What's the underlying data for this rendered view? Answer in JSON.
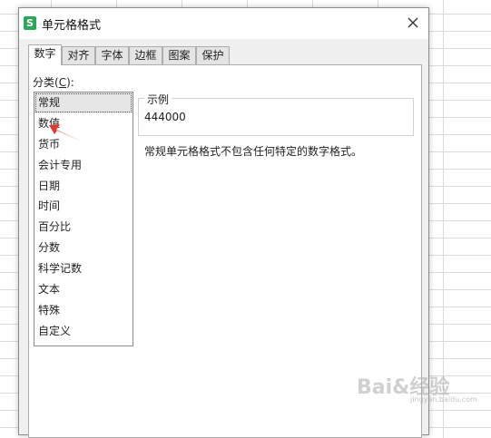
{
  "window": {
    "title": "单元格格式",
    "app_icon_glyph": "S",
    "close_icon": "close-icon"
  },
  "tabs": [
    {
      "label": "数字",
      "active": true
    },
    {
      "label": "对齐",
      "active": false
    },
    {
      "label": "字体",
      "active": false
    },
    {
      "label": "边框",
      "active": false
    },
    {
      "label": "图案",
      "active": false
    },
    {
      "label": "保护",
      "active": false
    }
  ],
  "category": {
    "label_prefix": "分类(",
    "label_accel": "C",
    "label_suffix": "):",
    "items": [
      "常规",
      "数值",
      "货币",
      "会计专用",
      "日期",
      "时间",
      "百分比",
      "分数",
      "科学记数",
      "文本",
      "特殊",
      "自定义"
    ],
    "selected_index": 0
  },
  "sample": {
    "legend": "示例",
    "value": "444000"
  },
  "description": "常规单元格格式不包含任何特定的数字格式。",
  "annotation": {
    "arrow_color": "#e03a2e"
  },
  "watermark": {
    "text": "Bai&经验",
    "sub": "jingyan.baidu.com"
  }
}
